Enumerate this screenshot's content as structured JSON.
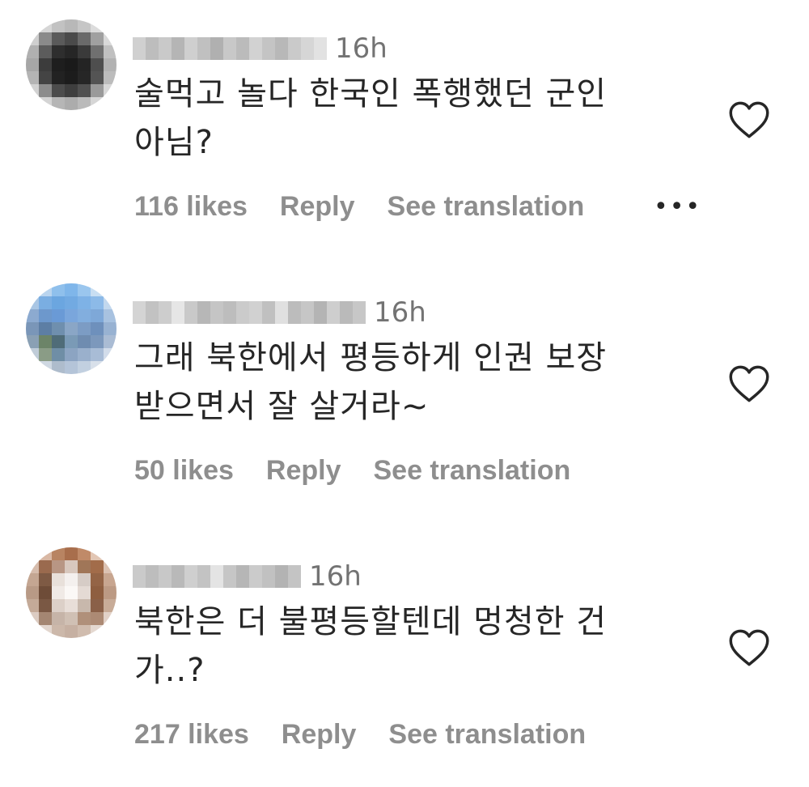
{
  "comments": [
    {
      "time": "16h",
      "text_line1": "술먹고 놀다 한국인 폭행했던 군인",
      "text_line2": "아님?",
      "likes": "116 likes",
      "reply": "Reply",
      "translate": "See translation",
      "more": "•••",
      "icons": {
        "like": "heart-outline-icon",
        "more": "more-options-icon"
      }
    },
    {
      "time": "16h",
      "text_line1": "그래 북한에서 평등하게 인권 보장",
      "text_line2": "받으면서 잘 살거라~",
      "likes": "50 likes",
      "reply": "Reply",
      "translate": "See translation",
      "icons": {
        "like": "heart-outline-icon"
      }
    },
    {
      "time": "16h",
      "text_line1": "북한은 더 불평등할텐데 멍청한 건",
      "text_line2": "가..?",
      "likes": "217 likes",
      "reply": "Reply",
      "translate": "See translation",
      "icons": {
        "like": "heart-outline-icon"
      }
    }
  ],
  "colors": {
    "text": "#262626",
    "secondary": "#8e8e8e",
    "background": "#ffffff"
  }
}
